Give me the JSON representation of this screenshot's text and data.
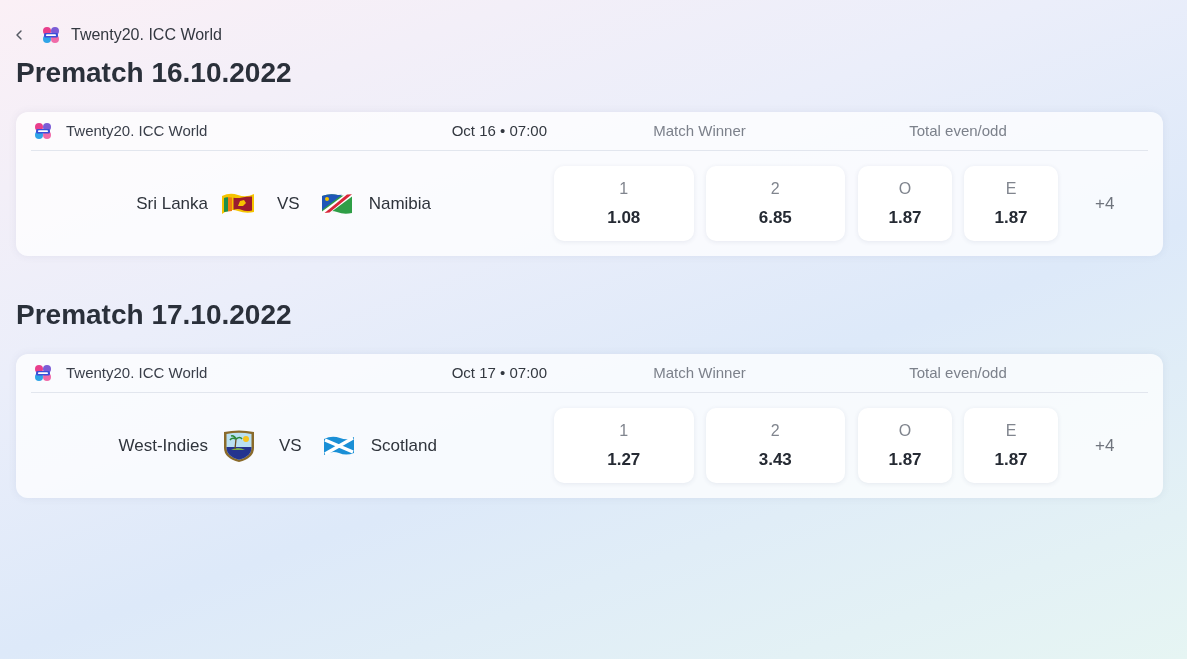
{
  "breadcrumb": {
    "title": "Twenty20. ICC World"
  },
  "sections": [
    {
      "heading": "Prematch 16.10.2022",
      "matches": [
        {
          "league": "Twenty20. ICC World",
          "datetime": "Oct 16 • 07:00",
          "home": {
            "name": "Sri Lanka",
            "kind": "lion"
          },
          "separator": "VS",
          "away": {
            "name": "Namibia",
            "kind": "diagonal"
          },
          "markets": [
            {
              "title": "Match Winner",
              "odds": [
                {
                  "label": "1",
                  "value": "1.08"
                },
                {
                  "label": "2",
                  "value": "6.85"
                }
              ]
            },
            {
              "title": "Total even/odd",
              "odds": [
                {
                  "label": "O",
                  "value": "1.87"
                },
                {
                  "label": "E",
                  "value": "1.87"
                }
              ]
            }
          ],
          "more": "+4"
        }
      ]
    },
    {
      "heading": "Prematch 17.10.2022",
      "matches": [
        {
          "league": "Twenty20. ICC World",
          "datetime": "Oct 17 • 07:00",
          "home": {
            "name": "West-Indies",
            "kind": "crest"
          },
          "separator": "VS",
          "away": {
            "name": "Scotland",
            "kind": "saltire"
          },
          "markets": [
            {
              "title": "Match Winner",
              "odds": [
                {
                  "label": "1",
                  "value": "1.27"
                },
                {
                  "label": "2",
                  "value": "3.43"
                }
              ]
            },
            {
              "title": "Total even/odd",
              "odds": [
                {
                  "label": "O",
                  "value": "1.87"
                },
                {
                  "label": "E",
                  "value": "1.87"
                }
              ]
            }
          ],
          "more": "+4"
        }
      ]
    }
  ]
}
